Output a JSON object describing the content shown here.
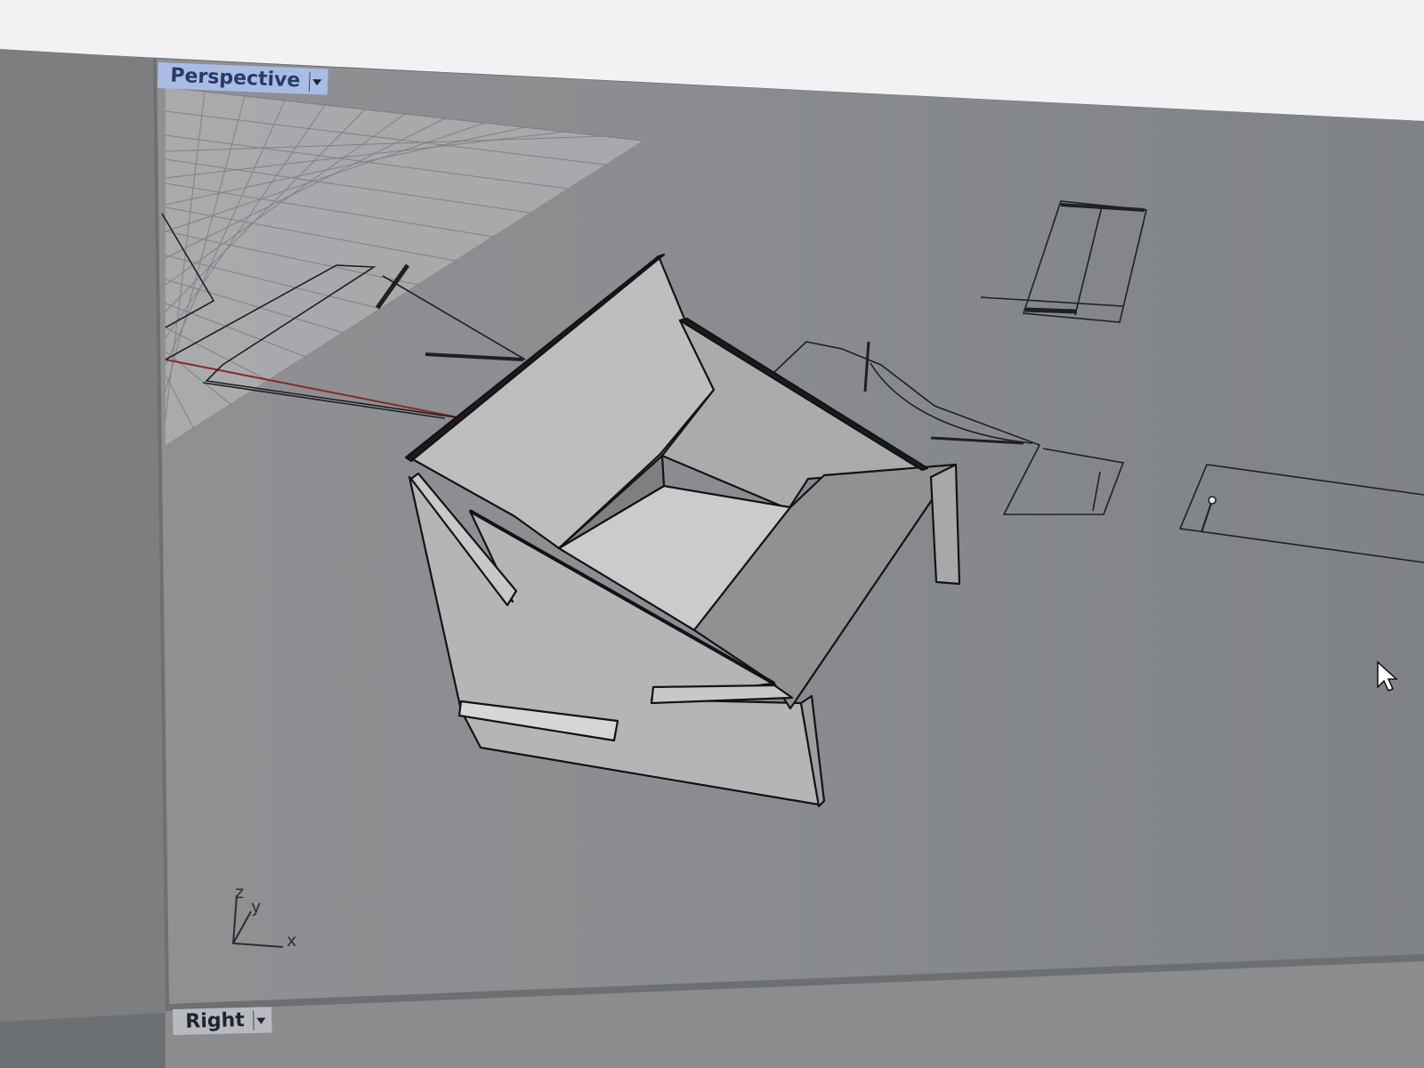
{
  "viewports": {
    "top_label": "Perspective",
    "bottom_label": "Right"
  },
  "axes": {
    "z": "z",
    "y": "y",
    "x": "x"
  },
  "icons": {
    "viewport_menu": "chevron-down-icon",
    "cursor": "mouse-pointer-icon",
    "axis": "world-axes-icon"
  },
  "colors": {
    "viewport_bg": "#8c8e90",
    "active_tab": "#a9bce4",
    "model_fill": "#b9bbbd",
    "grid": "#6e7277",
    "x_axis": "#8a2a2a"
  }
}
